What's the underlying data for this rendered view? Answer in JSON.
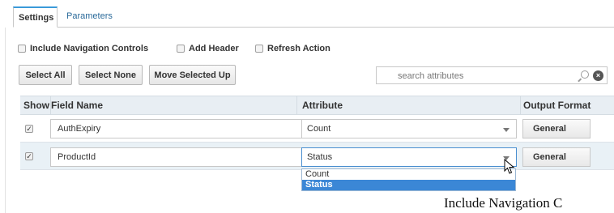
{
  "tabs": [
    {
      "label": "Settings",
      "active": true
    },
    {
      "label": "Parameters",
      "active": false
    }
  ],
  "options": [
    {
      "label": "Include Navigation Controls",
      "checked": false
    },
    {
      "label": "Add Header",
      "checked": false
    },
    {
      "label": "Refresh Action",
      "checked": false
    }
  ],
  "buttons": {
    "select_all": "Select All",
    "select_none": "Select None",
    "move_selected_up": "Move Selected Up"
  },
  "search": {
    "placeholder": "search attributes",
    "icon": "search-icon",
    "clear_icon": "clear-icon"
  },
  "table": {
    "headers": {
      "show": "Show",
      "field_name": "Field Name",
      "attribute": "Attribute",
      "output_format": "Output Format"
    },
    "rows": [
      {
        "show": true,
        "field_name": "AuthExpiry",
        "attribute": "Count",
        "output_format": "General"
      },
      {
        "show": true,
        "field_name": "ProductId",
        "attribute": "Status",
        "output_format": "General"
      }
    ]
  },
  "dropdown": {
    "options": [
      "Count",
      "Status"
    ],
    "selected": "Status"
  },
  "footer_text": "Include Navigation C",
  "colors": {
    "accent": "#3a9ad9",
    "header_bg": "#e8eef3",
    "selected_row_bg": "#e9f1f6",
    "dropdown_selected": "#3b87d6"
  }
}
